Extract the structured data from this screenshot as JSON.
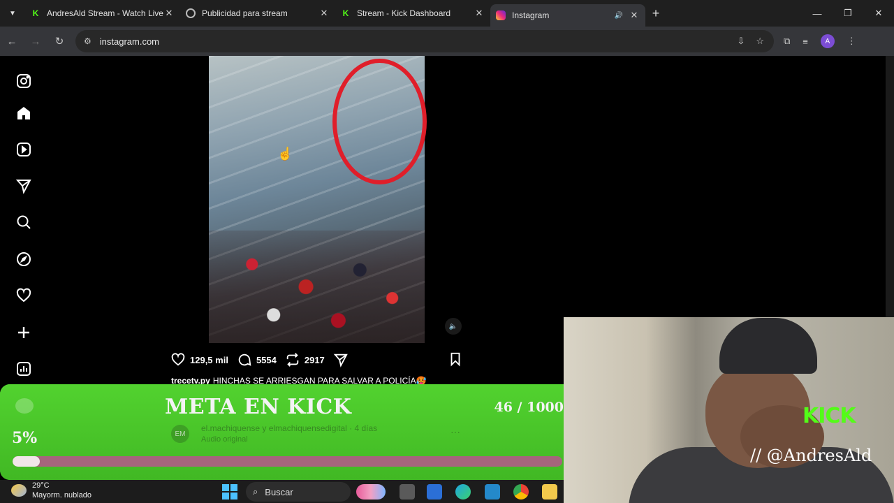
{
  "browser": {
    "tabs": [
      {
        "label": "AndresAld Stream - Watch Live",
        "favicon": "kick-icon"
      },
      {
        "label": "Publicidad para stream",
        "favicon": "chatgpt-icon"
      },
      {
        "label": "Stream - Kick Dashboard",
        "favicon": "kick-icon"
      },
      {
        "label": "Instagram",
        "favicon": "instagram-icon",
        "active": true
      }
    ],
    "url": "instagram.com",
    "profile_initial": "A"
  },
  "post": {
    "likes": "129,5 mil",
    "comments": "5554",
    "reposts": "2917",
    "author": "trecetv.py",
    "caption": "HINCHAS SE ARRIESGAN PARA SALVAR A POLICÍA🥵",
    "next_author": "el.machiquense y elmachiquensedigital",
    "next_time": "· 4 días",
    "next_audio": "Audio original",
    "next_avatar": "EM",
    "more": "···"
  },
  "goal": {
    "title": "META EN KICK",
    "count": "46 / 1000",
    "percent": "5%",
    "progress": 0.05
  },
  "stream": {
    "brand": "KICK",
    "handle": "// @AndresAld"
  },
  "taskbar": {
    "temperature": "29°C",
    "weather": "Mayorm. nublado",
    "search_placeholder": "Buscar"
  },
  "colors": {
    "kick_green": "#53fc18",
    "goal_green": "#4bc92a",
    "annotation_red": "#e01e2a"
  }
}
